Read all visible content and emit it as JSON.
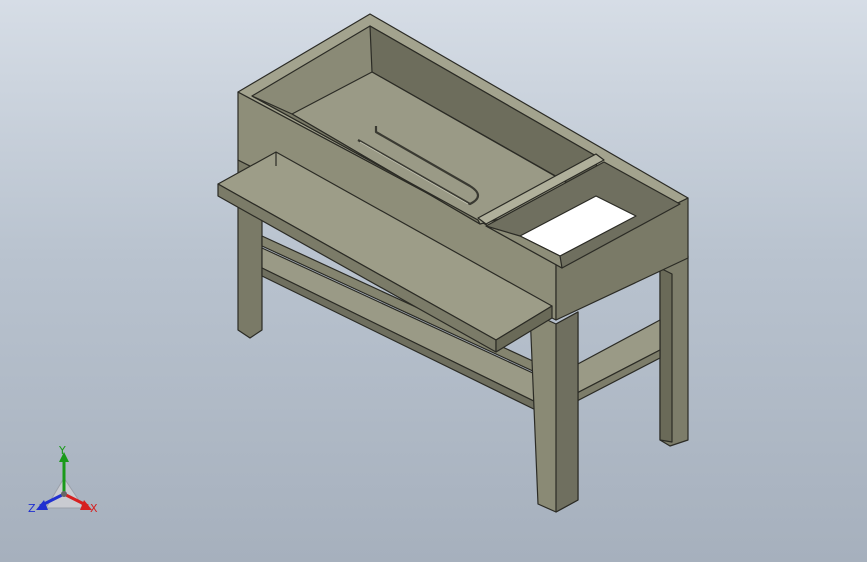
{
  "viewport": {
    "background_top": "#d6dde6",
    "background_bottom": "#a6b0bd"
  },
  "model": {
    "body_color": "#8e8e79",
    "edge_color": "#2b2b25",
    "light_face": "#a3a38e",
    "dark_face": "#6f6f5f",
    "inner_floor": "#9a9a86"
  },
  "triad": {
    "x_label": "X",
    "y_label": "Y",
    "z_label": "Z",
    "x_color": "#d62020",
    "y_color": "#1a9a1a",
    "z_color": "#2030d0"
  }
}
